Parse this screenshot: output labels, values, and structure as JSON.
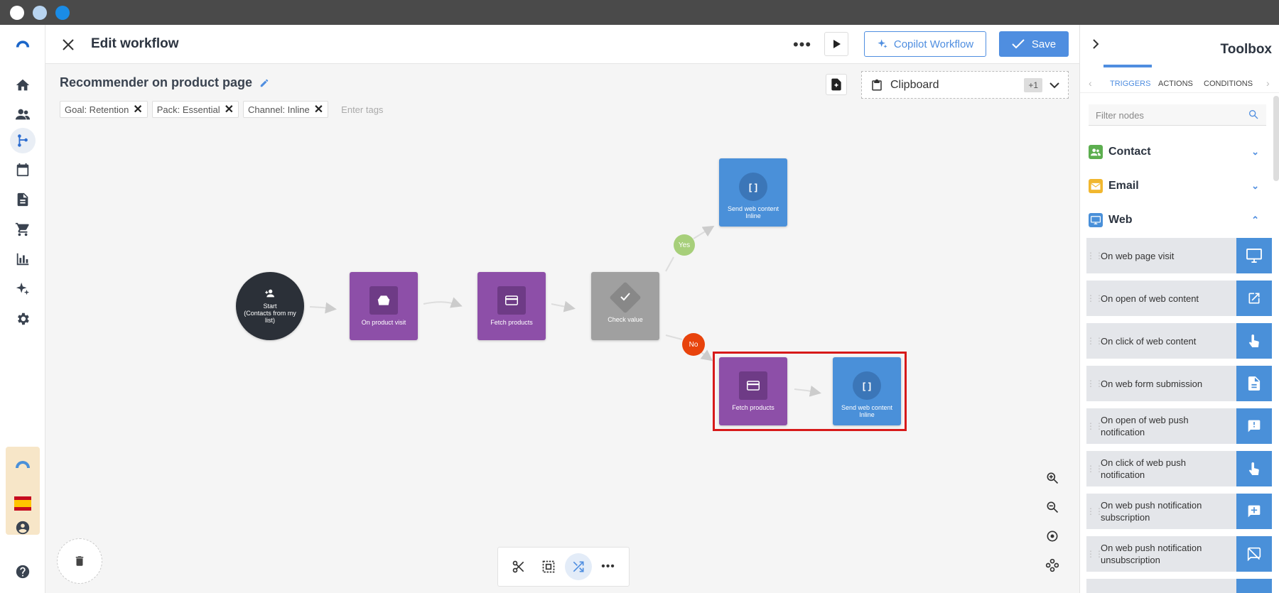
{
  "window": {
    "dot_colors": [
      "#ffffff",
      "#b8d4f0",
      "#1a8ce6"
    ]
  },
  "header": {
    "title": "Edit workflow",
    "copilot_label": "Copilot Workflow",
    "save_label": "Save"
  },
  "workflow": {
    "name": "Recommender on product page",
    "tags": [
      "Goal: Retention",
      "Pack: Essential",
      "Channel: Inline"
    ],
    "tags_placeholder": "Enter tags",
    "clipboard_label": "Clipboard",
    "clipboard_badge": "+1",
    "nodes": {
      "start": [
        "Start",
        "(Contacts from my",
        "list)"
      ],
      "product_visit": "On product visit",
      "fetch1": "Fetch products",
      "check": "Check value",
      "send_yes": [
        "Send web content",
        "Inline"
      ],
      "fetch2": "Fetch products",
      "send_no": [
        "Send web content",
        "Inline"
      ],
      "yes": "Yes",
      "no": "No"
    }
  },
  "toolbox": {
    "title": "Toolbox",
    "tabs": [
      "TRIGGERS",
      "ACTIONS",
      "CONDITIONS"
    ],
    "filter_placeholder": "Filter nodes",
    "categories": [
      {
        "label": "Contact",
        "color": "#5cae4f",
        "expanded": false
      },
      {
        "label": "Email",
        "color": "#f1b72f",
        "expanded": false
      },
      {
        "label": "Web",
        "color": "#4a90d9",
        "expanded": true
      }
    ],
    "items": [
      {
        "label": "On web page visit",
        "icon": "monitor-icon"
      },
      {
        "label": "On open of web content",
        "icon": "open-external-icon"
      },
      {
        "label": "On click of web content",
        "icon": "hand-pointer-icon"
      },
      {
        "label": "On web form submission",
        "icon": "form-document-icon"
      },
      {
        "label": "On open of web push notification",
        "icon": "notification-icon"
      },
      {
        "label": "On click of web push notification",
        "icon": "hand-pointer-icon"
      },
      {
        "label": "On web push notification subscription",
        "icon": "subscribe-icon"
      },
      {
        "label": "On web push notification unsubscription",
        "icon": "unsubscribe-icon"
      }
    ]
  },
  "colors": {
    "accent": "#4f8ee0",
    "selection": "#d71a1a"
  }
}
